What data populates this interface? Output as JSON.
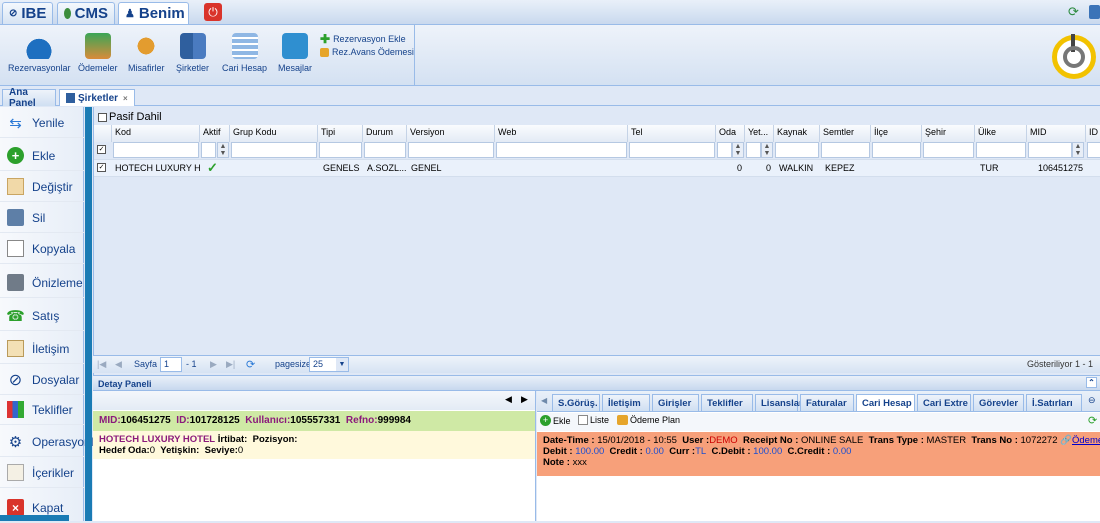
{
  "top_tabs": {
    "ibe": "IBE",
    "cms": "CMS",
    "benim": "Benim"
  },
  "toolbar": {
    "reservations": "Rezervasyonlar",
    "payments": "Ödemeler",
    "guests": "Misafirler",
    "companies": "Şirketler",
    "current_account": "Cari Hesap",
    "messages": "Mesajlar",
    "add_reservation": "Rezervasyon Ekle",
    "res_advance_payment": "Rez.Avans Ödemesi"
  },
  "content_tabs": {
    "main_panel": "Ana Panel",
    "companies": "Şirketler"
  },
  "sidebar": {
    "items": [
      {
        "label": "Yenile",
        "icon": "refresh-icon"
      },
      {
        "label": "Ekle",
        "icon": "add-icon"
      },
      {
        "label": "Değiştir",
        "icon": "edit-icon"
      },
      {
        "label": "Sil",
        "icon": "trash-icon"
      },
      {
        "label": "Kopyala",
        "icon": "copy-icon"
      },
      {
        "label": "Önizleme",
        "icon": "printer-icon"
      },
      {
        "label": "Satış",
        "icon": "phone-icon"
      },
      {
        "label": "İletişim",
        "icon": "contact-card-icon"
      },
      {
        "label": "Dosyalar",
        "icon": "paperclip-icon"
      },
      {
        "label": "Teklifler",
        "icon": "books-icon"
      },
      {
        "label": "Operasyonlar",
        "icon": "gears-icon"
      },
      {
        "label": "İçerikler",
        "icon": "pencil-note-icon"
      },
      {
        "label": "Kapat",
        "icon": "close-icon"
      }
    ]
  },
  "grid": {
    "pasif_dahil": "Pasif Dahil",
    "columns": [
      "Kod",
      "Aktif",
      "Grup Kodu",
      "Tipi",
      "Durum",
      "Versiyon",
      "Web",
      "Tel",
      "Oda",
      "Yet...",
      "Kaynak",
      "Semtler",
      "İlçe",
      "Şehir",
      "Ülke",
      "MID",
      "ID"
    ],
    "row": {
      "kod": "HOTECH LUXURY H...",
      "tipi": "GENELS",
      "durum": "A.SOZL...",
      "versiyon": "GENEL",
      "oda": "0",
      "yet": "0",
      "kaynak": "WALKIN",
      "semtler": "KEPEZ",
      "ulke": "TUR",
      "mid": "106451275"
    }
  },
  "pager": {
    "sayfa": "Sayfa",
    "page": "1",
    "of": "- 1",
    "pagesize_label": "pagesize",
    "pagesize": "25",
    "showing": "Gösteriliyor 1 - 1"
  },
  "detail": {
    "title": "Detay Paneli",
    "mid_label": "MID:",
    "mid": "106451275",
    "id_label": "ID:",
    "id": "101728125",
    "user_label": "Kullanıcı:",
    "user": "105557331",
    "refno_label": "Refno:",
    "refno": "999984",
    "hotel_name": "HOTECH LUXURY HOTEL",
    "contact_label": "İrtibat:",
    "position_label": "Pozisyon:",
    "target_room_label": "Hedef Oda:",
    "target_room": "0",
    "authority_label": "Yetişkin:",
    "level_label": "Seviye:",
    "level": "0"
  },
  "bottom_tabs": [
    "S.Görüş.",
    "İletişim",
    "Girişler",
    "Teklifler",
    "Lisanslar",
    "Faturalar",
    "Cari Hesap",
    "Cari Extre",
    "Görevler",
    "İ.Satırları"
  ],
  "bottom_toolbar": {
    "add": "Ekle",
    "list": "Liste",
    "payment_plan": "Ödeme Plan"
  },
  "record": {
    "datetime_label": "Date-Time :",
    "datetime": "15/01/2018 - 10:55",
    "user_label": "User :",
    "user": "DEMO",
    "receipt_label": "Receipt No :",
    "receipt": "ONLINE SALE",
    "trans_type_label": "Trans Type :",
    "trans_type": "MASTER",
    "trans_no_label": "Trans No :",
    "trans_no": "1072272",
    "payment_link": "Ödeme Linki",
    "debit_label": "Debit :",
    "debit": "100.00",
    "credit_label": "Credit :",
    "credit": "0.00",
    "curr_label": "Curr :",
    "curr": "TL",
    "cdebit_label": "C.Debit :",
    "cdebit": "100.00",
    "ccredit_label": "C.Credit :",
    "ccredit": "0.00",
    "note_label": "Note :",
    "note": "xxx"
  },
  "colors": {
    "accent": "#15428b",
    "highlight_row": "#cfe9a5",
    "record_bg": "#f7a07a",
    "sidebar_bar": "#1a7bb4"
  }
}
